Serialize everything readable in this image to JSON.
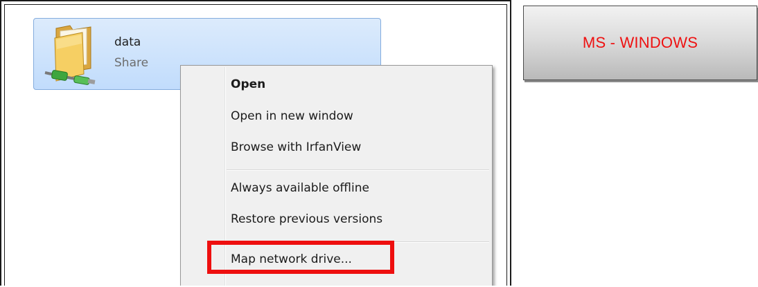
{
  "share_tile": {
    "name": "data",
    "type_label": "Share"
  },
  "context_menu": {
    "items": [
      {
        "label": "Open",
        "bold": true
      },
      {
        "label": "Open in new window"
      },
      {
        "label": "Browse with IrfanView"
      },
      {
        "label": "Always available offline"
      },
      {
        "label": "Restore previous versions"
      },
      {
        "label": "Map network drive..."
      }
    ],
    "highlighted_item": "Map network drive..."
  },
  "os_label": {
    "text": "MS - WINDOWS",
    "color": "#ee1111"
  },
  "colors": {
    "highlight_border": "#ee0f0f",
    "tile_selection": "#c1dcfc"
  },
  "icons": {
    "share_folder": "network-share-folder-icon"
  }
}
